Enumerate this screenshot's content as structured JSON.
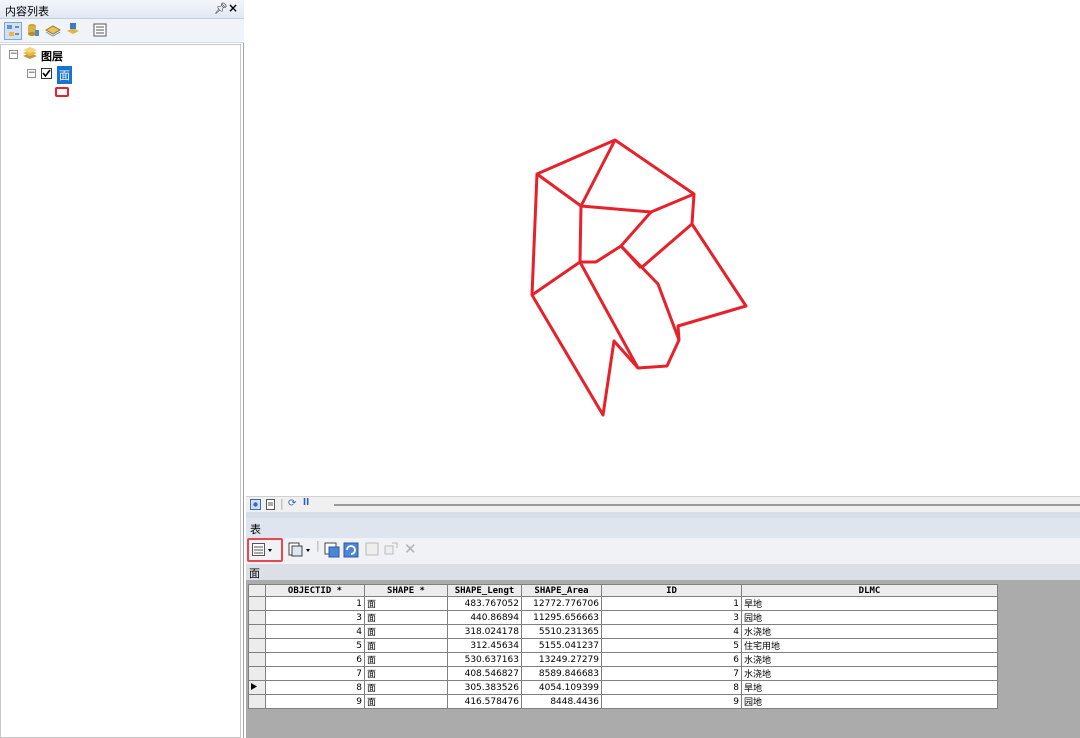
{
  "toc": {
    "title": "内容列表",
    "layers_root": "图层",
    "layer_name": "面"
  },
  "table": {
    "window_title": "表",
    "tab_label": "面",
    "columns": [
      "OBJECTID *",
      "SHAPE *",
      "SHAPE_Lengt",
      "SHAPE_Area",
      "ID",
      "DLMC"
    ],
    "rows": [
      {
        "objectid": "1",
        "shape": "面",
        "length": "483.767052",
        "area": "12772.776706",
        "id": "1",
        "dlmc": "旱地"
      },
      {
        "objectid": "3",
        "shape": "面",
        "length": "440.86894",
        "area": "11295.656663",
        "id": "3",
        "dlmc": "园地"
      },
      {
        "objectid": "4",
        "shape": "面",
        "length": "318.024178",
        "area": "5510.231365",
        "id": "4",
        "dlmc": "水浇地"
      },
      {
        "objectid": "5",
        "shape": "面",
        "length": "312.45634",
        "area": "5155.041237",
        "id": "5",
        "dlmc": "住宅用地"
      },
      {
        "objectid": "6",
        "shape": "面",
        "length": "530.637163",
        "area": "13249.27279",
        "id": "6",
        "dlmc": "水浇地"
      },
      {
        "objectid": "7",
        "shape": "面",
        "length": "408.546827",
        "area": "8589.846683",
        "id": "7",
        "dlmc": "水浇地"
      },
      {
        "objectid": "8",
        "shape": "面",
        "length": "305.383526",
        "area": "4054.109399",
        "id": "8",
        "dlmc": "旱地"
      },
      {
        "objectid": "9",
        "shape": "面",
        "length": "416.578476",
        "area": "8448.4436",
        "id": "9",
        "dlmc": "园地"
      }
    ],
    "current_row_index": 6
  },
  "colors": {
    "polygon_outline": "#e8202a",
    "highlight_box": "#e8474f",
    "layer_selected_bg": "#1874d0"
  },
  "icons": [
    "list-by-drawing-order-icon",
    "list-by-source-icon",
    "list-by-visibility-icon",
    "list-by-selection-icon",
    "options-icon",
    "pin-icon",
    "close-icon",
    "layers-icon",
    "table-options-icon",
    "related-tables-icon",
    "select-by-attributes-icon",
    "switch-selection-icon",
    "clear-selection-icon",
    "zoom-to-selected-icon",
    "delete-selected-icon",
    "data-view-icon",
    "layout-view-icon",
    "refresh-icon",
    "pause-icon"
  ]
}
